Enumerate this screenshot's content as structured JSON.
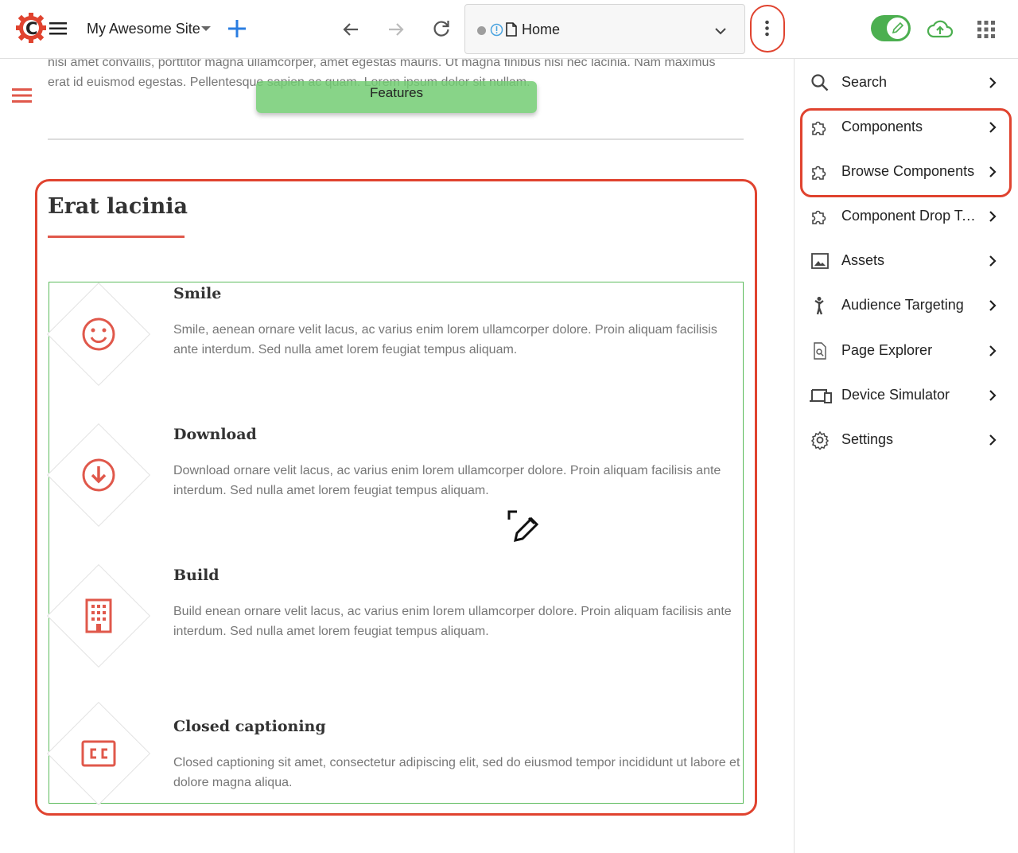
{
  "toolbar": {
    "site_name": "My Awesome Site",
    "url_label": "Home",
    "toggle_state": "on",
    "accent": "#2a7de1",
    "toggle_color": "#4caf50",
    "highlight_color": "#e0432f"
  },
  "content": {
    "faint_line_1": "nisi amet convallis, porttitor magna ullamcorper, amet egestas mauris. Ut magna finibus nisi nec lacinia. Nam maximus",
    "faint_line_2": "erat id euismod egestas. Pellentesque sapien ac quam. Lorem ipsum dolor sit nullam.",
    "features_pill": "Features",
    "section_title": "Erat lacinia",
    "features": [
      {
        "title": "Smile",
        "desc": "Smile, aenean ornare velit lacus, ac varius enim lorem ullamcorper dolore. Proin aliquam facilisis ante interdum. Sed nulla amet lorem feugiat tempus aliquam.",
        "icon": "smile-icon"
      },
      {
        "title": "Download",
        "desc": "Download ornare velit lacus, ac varius enim lorem ullamcorper dolore. Proin aliquam facilisis ante interdum. Sed nulla amet lorem feugiat tempus aliquam.",
        "icon": "download-icon"
      },
      {
        "title": "Build",
        "desc": "Build enean ornare velit lacus, ac varius enim lorem ullamcorper dolore. Proin aliquam facilisis ante interdum. Sed nulla amet lorem feugiat tempus aliquam.",
        "icon": "building-icon"
      },
      {
        "title": "Closed captioning",
        "desc": "Closed captioning sit amet, consectetur adipiscing elit, sed do eiusmod tempor incididunt ut labore et dolore magna aliqua.",
        "icon": "closed-captioning-icon"
      }
    ],
    "icon_color": "#e0584b"
  },
  "panel": {
    "items": [
      {
        "label": "Search",
        "icon": "search-icon"
      },
      {
        "label": "Components",
        "icon": "puzzle-icon"
      },
      {
        "label": "Browse Components",
        "icon": "puzzle-icon"
      },
      {
        "label": "Component Drop Targets",
        "icon": "puzzle-icon"
      },
      {
        "label": "Assets",
        "icon": "image-icon"
      },
      {
        "label": "Audience Targeting",
        "icon": "person-icon"
      },
      {
        "label": "Page Explorer",
        "icon": "page-search-icon"
      },
      {
        "label": "Device Simulator",
        "icon": "devices-icon"
      },
      {
        "label": "Settings",
        "icon": "gear-icon"
      }
    ]
  }
}
